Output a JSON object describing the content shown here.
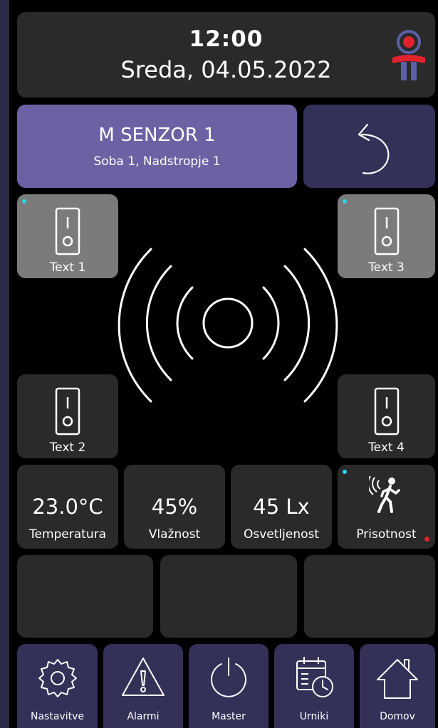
{
  "header": {
    "time": "12:00",
    "date": "Sreda, 04.05.2022"
  },
  "device": {
    "name": "M SENZOR 1",
    "location": "Soba 1, Nadstropje 1"
  },
  "switches": [
    {
      "label": "Text 1",
      "icon": "switch-icon"
    },
    {
      "label": "Text 2",
      "icon": "switch-icon"
    },
    {
      "label": "Text 3",
      "icon": "switch-icon"
    },
    {
      "label": "Text 4",
      "icon": "switch-icon"
    }
  ],
  "readouts": {
    "temperature": {
      "value": "23.0°C",
      "label": "Temperatura"
    },
    "humidity": {
      "value": "45%",
      "label": "Vlažnost"
    },
    "illuminance": {
      "value": "45 Lx",
      "label": "Osvetljenost"
    },
    "presence": {
      "label": "Prisotnost",
      "icon": "walking-person-motion-icon"
    }
  },
  "nav": [
    {
      "label": "Nastavitve",
      "icon": "gear-icon"
    },
    {
      "label": "Alarmi",
      "icon": "warning-icon"
    },
    {
      "label": "Master",
      "icon": "power-icon"
    },
    {
      "label": "Urniki",
      "icon": "calendar-clock-icon"
    },
    {
      "label": "Domov",
      "icon": "home-icon"
    }
  ],
  "colors": {
    "background": "#2c2a49",
    "panel": "#000000",
    "card_dark": "#2a2a2a",
    "card_purple": "#6a62a3",
    "card_purple_dark": "#333158",
    "switch_card": "#7b7b7b",
    "status_led": "#2dd4e3",
    "alert_dot": "#e0232d"
  }
}
